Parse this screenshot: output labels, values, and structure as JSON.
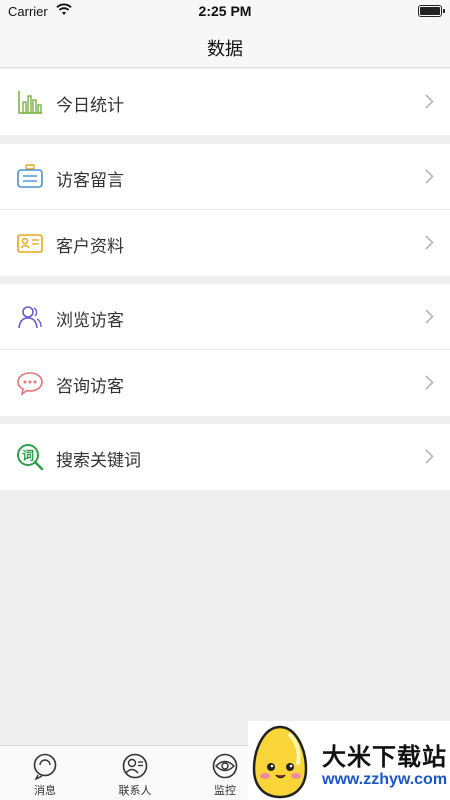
{
  "status_bar": {
    "carrier": "Carrier",
    "time": "2:25 PM"
  },
  "nav": {
    "title": "数据"
  },
  "groups": [
    {
      "items": [
        {
          "label": "今日统计",
          "icon": "bar-chart-icon"
        }
      ]
    },
    {
      "items": [
        {
          "label": "访客留言",
          "icon": "message-board-icon"
        },
        {
          "label": "客户资料",
          "icon": "id-card-icon"
        }
      ]
    },
    {
      "items": [
        {
          "label": "浏览访客",
          "icon": "visitors-icon"
        },
        {
          "label": "咨询访客",
          "icon": "chat-bubble-icon"
        }
      ]
    },
    {
      "items": [
        {
          "label": "搜索关键词",
          "icon": "keyword-search-icon"
        }
      ]
    }
  ],
  "tabs": [
    {
      "label": "消息",
      "icon": "message-icon"
    },
    {
      "label": "联系人",
      "icon": "contacts-icon"
    },
    {
      "label": "监控",
      "icon": "eye-icon"
    }
  ],
  "watermark": {
    "title": "大米下载站",
    "url": "www.zzhyw.com"
  },
  "colors": {
    "background": "#efefef",
    "chart_icon": "#7cb342",
    "message_icon": "#4a90d9",
    "card_icon": "#e6a817",
    "visitor_icon": "#6a5acd",
    "chat_icon": "#e57373",
    "keyword_icon": "#2e9e4a",
    "watermark_url": "#1a56c4"
  }
}
